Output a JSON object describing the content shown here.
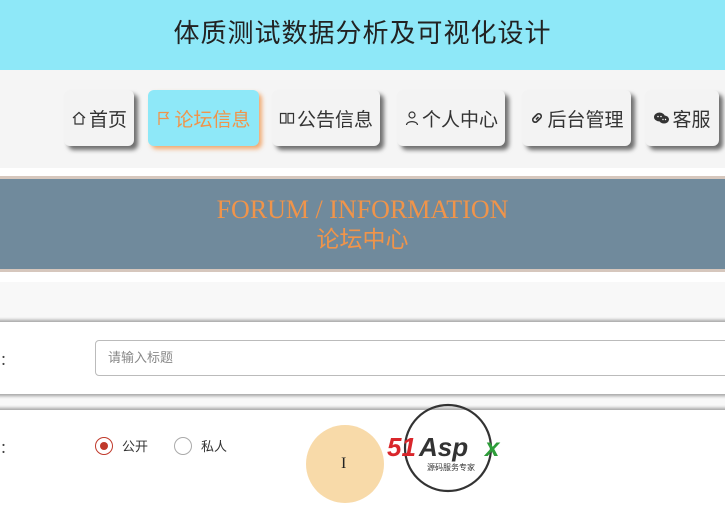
{
  "header": {
    "title": "体质测试数据分析及可视化设计"
  },
  "nav": {
    "items": [
      {
        "label": "首页",
        "icon": "home-icon"
      },
      {
        "label": "论坛信息",
        "icon": "flag-icon",
        "active": true
      },
      {
        "label": "公告信息",
        "icon": "book-icon"
      },
      {
        "label": "个人中心",
        "icon": "user-icon"
      },
      {
        "label": "后台管理",
        "icon": "link-icon"
      },
      {
        "label": "客服",
        "icon": "chat-icon"
      }
    ],
    "active_color": "#f0944a",
    "header_color": "#8ee8f8"
  },
  "banner": {
    "title_en": "FORUM / INFORMATION",
    "title_cn": "论坛中心",
    "background_color": "#708a9c"
  },
  "form": {
    "title_field": {
      "label": "：",
      "placeholder": "请输入标题",
      "value": ""
    },
    "visibility_field": {
      "label": "：",
      "options": [
        {
          "label": "公开",
          "checked": true
        },
        {
          "label": "私人",
          "checked": false
        }
      ]
    }
  },
  "watermark": {
    "brand": "51Aspx",
    "slogan": "源码服务专家"
  }
}
